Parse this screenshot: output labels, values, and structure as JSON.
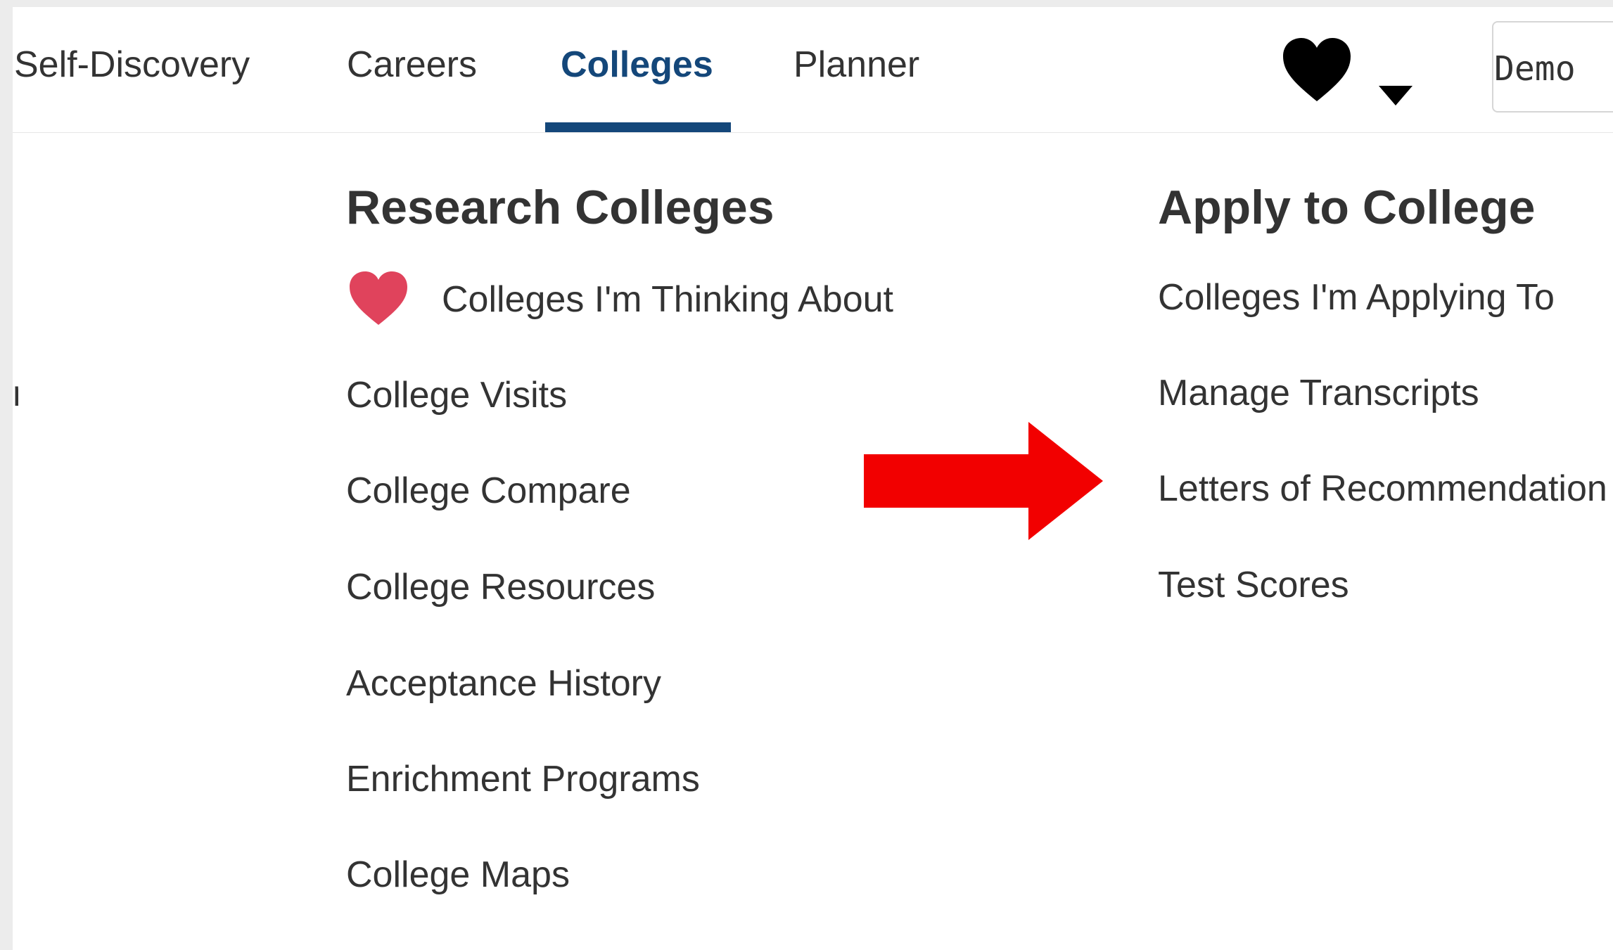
{
  "nav": {
    "items": [
      {
        "label": "Self-Discovery",
        "active": false
      },
      {
        "label": "Careers",
        "active": false
      },
      {
        "label": "Colleges",
        "active": true
      },
      {
        "label": "Planner",
        "active": false
      }
    ],
    "favorites_icon": "heart-icon",
    "dropdown_icon": "caret-down-icon",
    "user_name": "Demo",
    "active_color": "#14477a"
  },
  "left_partial_text": "n",
  "research": {
    "title": "Research Colleges",
    "items": [
      {
        "label": "Colleges I'm Thinking About",
        "icon": "heart-icon",
        "icon_color": "#e0435c"
      },
      {
        "label": "College Visits"
      },
      {
        "label": "College Compare"
      },
      {
        "label": "College Resources"
      },
      {
        "label": "Acceptance History"
      },
      {
        "label": "Enrichment Programs"
      },
      {
        "label": "College Maps"
      }
    ]
  },
  "apply": {
    "title": "Apply to College",
    "items": [
      {
        "label": "Colleges I'm Applying To"
      },
      {
        "label": "Manage Transcripts"
      },
      {
        "label": "Letters of Recommendation"
      },
      {
        "label": "Test Scores"
      }
    ]
  },
  "annotation": {
    "icon": "arrow-right-icon",
    "color": "#f20000",
    "points_to": "Letters of Recommendation"
  }
}
